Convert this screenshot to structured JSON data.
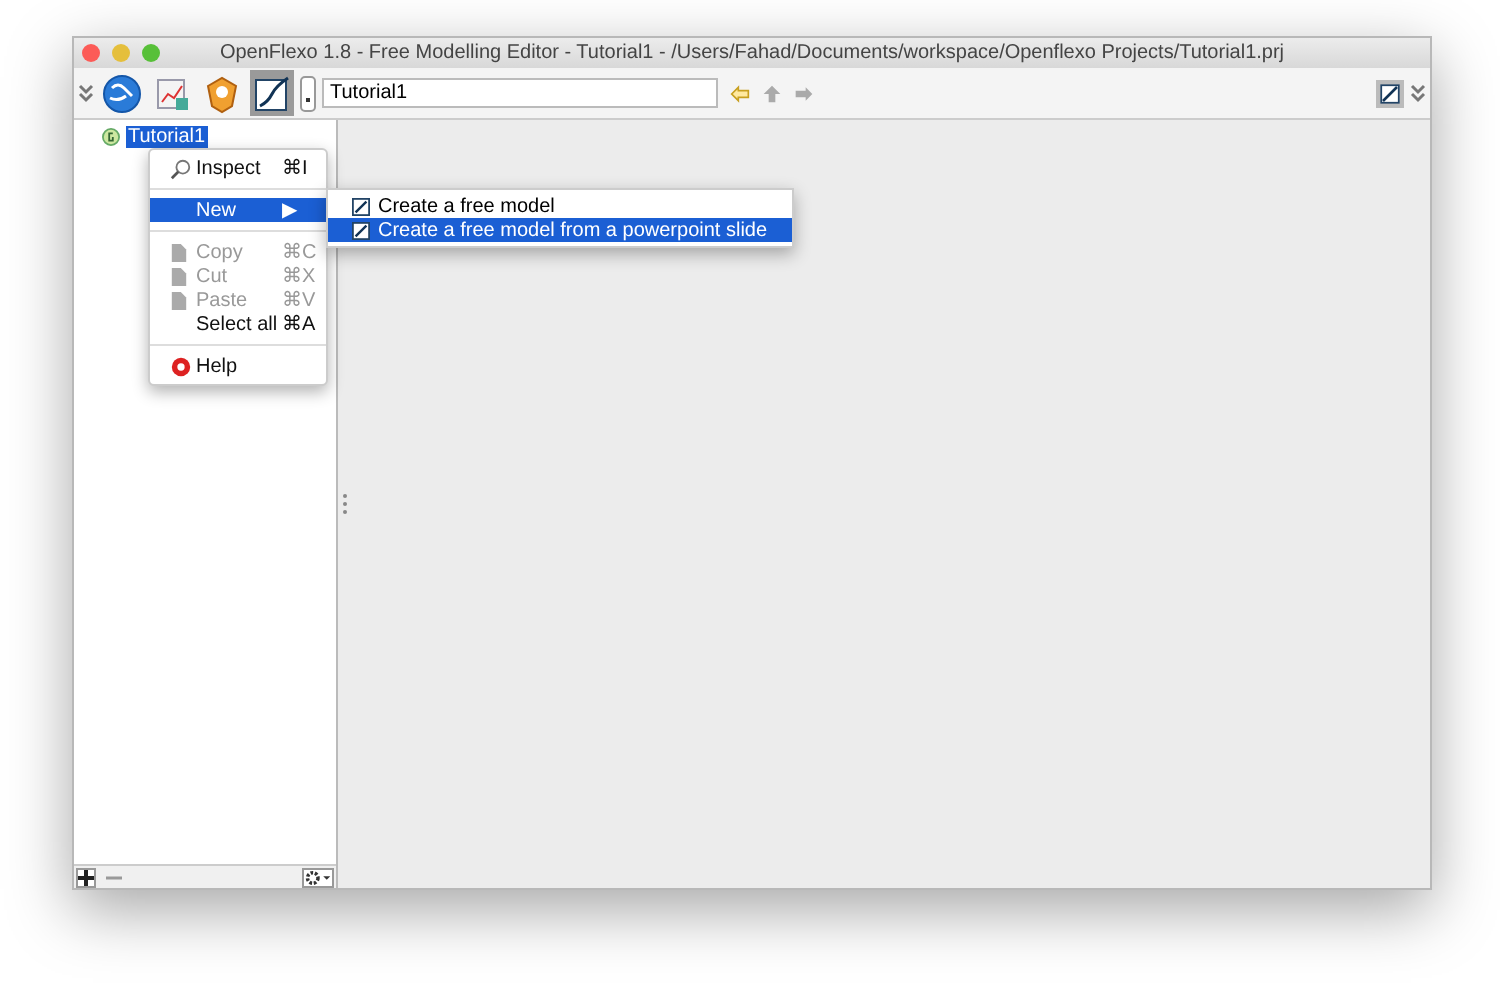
{
  "window": {
    "title": "OpenFlexo 1.8 - Free Modelling Editor - Tutorial1 - /Users/Fahad/Documents/workspace/Openflexo Projects/Tutorial1.prj"
  },
  "toolbar": {
    "project_field": {
      "value": "Tutorial1"
    },
    "tools": [
      {
        "kind": "globe",
        "selected": false
      },
      {
        "kind": "chart",
        "selected": false
      },
      {
        "kind": "badge",
        "selected": false
      },
      {
        "kind": "pen",
        "selected": true
      }
    ]
  },
  "tree": {
    "items": [
      {
        "label": "Tutorial1",
        "selected": true
      }
    ]
  },
  "context_menu": {
    "items": [
      {
        "kind": "inspect",
        "label": "Inspect",
        "shortcut": "⌘I",
        "disabled": false,
        "selected": false
      },
      {
        "kind": "separator"
      },
      {
        "kind": "submenu",
        "label": "New",
        "arrow": "▶",
        "selected": true
      },
      {
        "kind": "separator"
      },
      {
        "kind": "edit",
        "label": "Copy",
        "shortcut": "⌘C",
        "disabled": true,
        "selected": false
      },
      {
        "kind": "edit",
        "label": "Cut",
        "shortcut": "⌘X",
        "disabled": true,
        "selected": false
      },
      {
        "kind": "edit",
        "label": "Paste",
        "shortcut": "⌘V",
        "disabled": true,
        "selected": false
      },
      {
        "kind": "item",
        "label": "Select all",
        "shortcut": "⌘A",
        "disabled": false,
        "selected": false
      },
      {
        "kind": "separator"
      },
      {
        "kind": "help",
        "label": "Help",
        "disabled": false,
        "selected": false
      }
    ]
  },
  "submenu": {
    "items": [
      {
        "label": "Create a free model",
        "selected": false
      },
      {
        "label": "Create a free model from a powerpoint slide",
        "selected": true
      }
    ]
  }
}
